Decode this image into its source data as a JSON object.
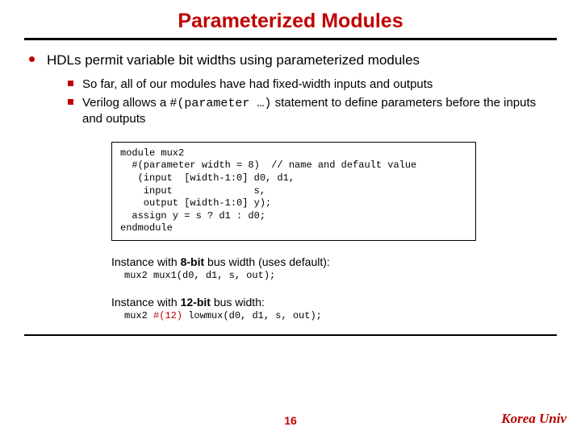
{
  "title": "Parameterized Modules",
  "bullet_main": "HDLs permit variable bit widths using parameterized modules",
  "sub1": "So far, all of our modules have had fixed-width inputs and outputs",
  "sub2_a": "Verilog allows a ",
  "sub2_code": "#(parameter …)",
  "sub2_b": "statement to define parameters before the inputs and outputs",
  "code": "module mux2\n  #(parameter width = 8)  // name and default value\n   (input  [width-1:0] d0, d1,\n    input              s,\n    output [width-1:0] y);\n  assign y = s ? d1 : d0;\nendmodule",
  "inst1_label_a": "Instance with ",
  "inst1_label_b": "8-bit",
  "inst1_label_c": " bus width (uses default):",
  "inst1_code": "mux2 mux1(d0, d1, s, out);",
  "inst2_label_a": "Instance with ",
  "inst2_label_b": "12-bit",
  "inst2_label_c": " bus width:",
  "inst2_code_a": "mux2 ",
  "inst2_code_b": "#(12)",
  "inst2_code_c": " lowmux(d0, d1, s, out);",
  "pagenum": "16",
  "univ": "Korea Univ"
}
